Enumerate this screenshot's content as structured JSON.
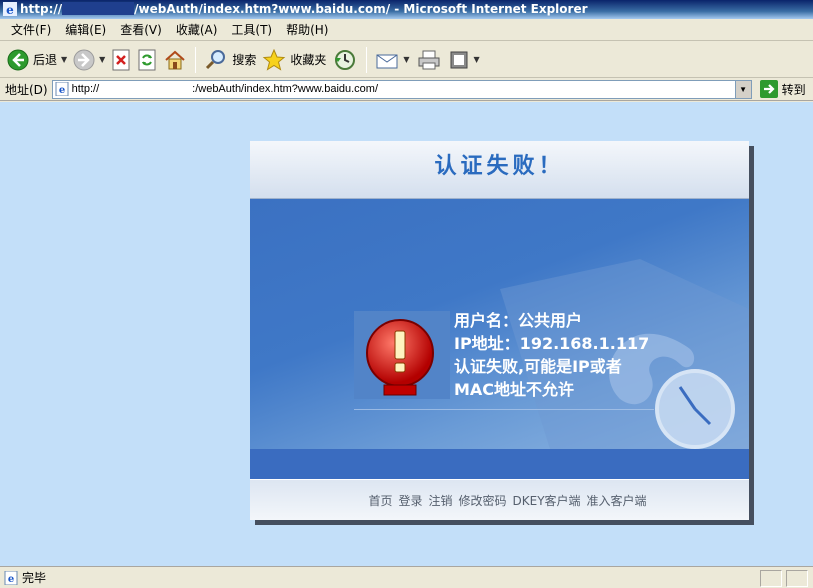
{
  "window": {
    "title_prefix": "http://",
    "title_suffix": "/webAuth/index.htm?www.baidu.com/ - Microsoft Internet Explorer"
  },
  "menu": [
    "文件(F)",
    "编辑(E)",
    "查看(V)",
    "收藏(A)",
    "工具(T)",
    "帮助(H)"
  ],
  "toolbar": {
    "back_label": "后退",
    "search_label": "搜索",
    "favorites_label": "收藏夹"
  },
  "address": {
    "label": "地址(D)",
    "url_prefix": "http://",
    "url_suffix": ":/webAuth/index.htm?www.baidu.com/",
    "go_label": "转到"
  },
  "page": {
    "title": "认证失败！",
    "message_lines": [
      "用户名：公共用户",
      "IP地址：192.168.1.117",
      "认证失败,可能是IP或者",
      "MAC地址不允许"
    ],
    "footer_links": [
      "首页",
      "登录",
      "注销",
      "修改密码",
      "DKEY客户端",
      "准入客户端"
    ]
  },
  "status": {
    "text": "完毕"
  }
}
